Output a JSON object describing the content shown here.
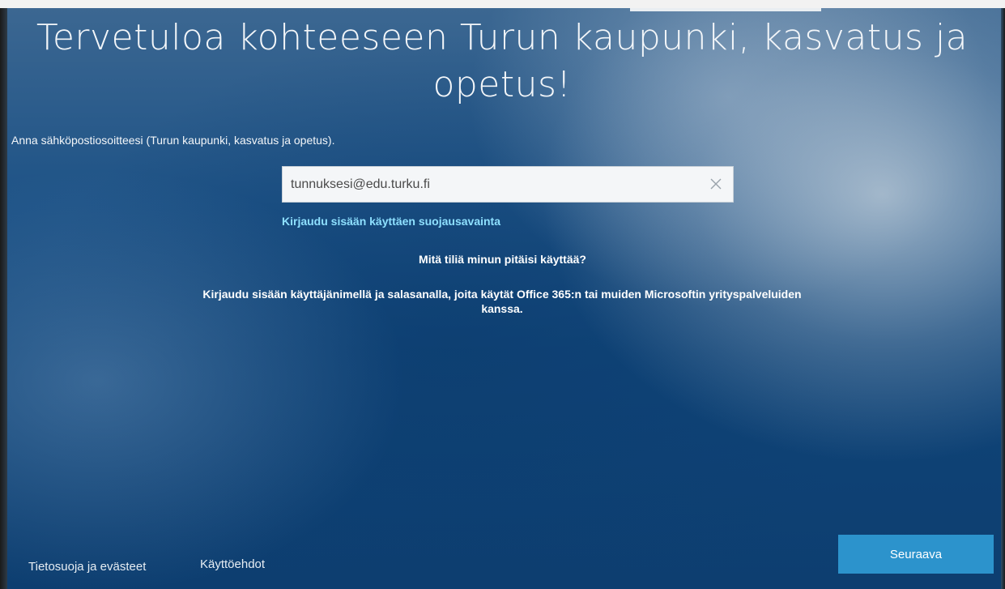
{
  "header": {
    "title": "Tervetuloa kohteeseen Turun kaupunki, kasvatus ja opetus!"
  },
  "form": {
    "instruction": "Anna sähköpostiosoitteesi (Turun kaupunki, kasvatus ja opetus).",
    "email_value": "tunnuksesi@edu.turku.fi",
    "clear_icon": "close-icon",
    "security_key_link": "Kirjaudu sisään käyttäen suojausavainta"
  },
  "help": {
    "question": "Mitä tiliä minun pitäisi käyttää?",
    "answer": "Kirjaudu sisään käyttäjänimellä ja salasanalla, joita käytät Office 365:n tai muiden Microsoftin yrityspalveluiden kanssa."
  },
  "footer": {
    "privacy_link": "Tietosuoja ja evästeet",
    "terms_link": "Käyttöehdot",
    "next_button": "Seuraava"
  },
  "colors": {
    "background": "#0f4478",
    "accent_button": "#2c93cc",
    "link": "#8ee0ff"
  }
}
